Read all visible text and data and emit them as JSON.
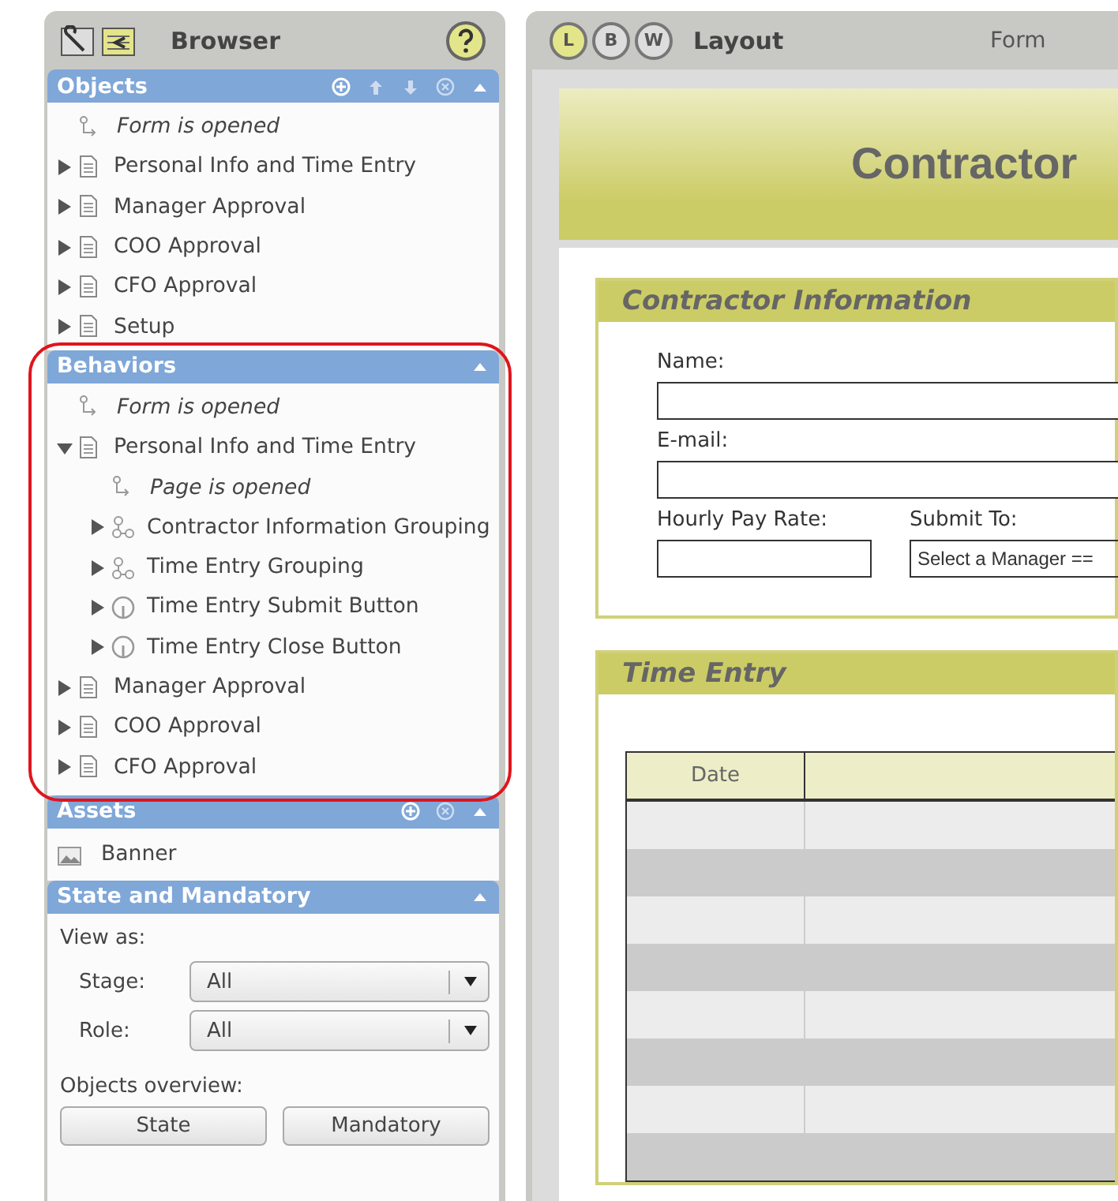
{
  "browser": {
    "title": "Browser",
    "objects": {
      "title": "Objects",
      "items": [
        {
          "kind": "event",
          "label": "Form is opened"
        },
        {
          "kind": "page",
          "label": "Personal Info and Time Entry",
          "expanded": false
        },
        {
          "kind": "page",
          "label": "Manager Approval",
          "expanded": false
        },
        {
          "kind": "page",
          "label": "COO Approval",
          "expanded": false
        },
        {
          "kind": "page",
          "label": "CFO Approval",
          "expanded": false
        },
        {
          "kind": "page",
          "label": "Setup",
          "expanded": false
        }
      ]
    },
    "behaviors": {
      "title": "Behaviors",
      "items": [
        {
          "kind": "event",
          "label": "Form is opened"
        },
        {
          "kind": "page",
          "label": "Personal Info and Time Entry",
          "expanded": true,
          "children": [
            {
              "kind": "event",
              "label": "Page is opened"
            },
            {
              "kind": "group",
              "label": "Contractor Information Grouping",
              "expanded": false
            },
            {
              "kind": "group",
              "label": "Time Entry Grouping",
              "expanded": false
            },
            {
              "kind": "button",
              "label": "Time Entry Submit Button",
              "expanded": false
            },
            {
              "kind": "button",
              "label": "Time Entry Close Button",
              "expanded": false
            }
          ]
        },
        {
          "kind": "page",
          "label": "Manager Approval",
          "expanded": false
        },
        {
          "kind": "page",
          "label": "COO Approval",
          "expanded": false
        },
        {
          "kind": "page",
          "label": "CFO Approval",
          "expanded": false
        }
      ]
    },
    "assets": {
      "title": "Assets",
      "items": [
        {
          "label": "Banner"
        }
      ]
    },
    "state_and_mandatory": {
      "title": "State and Mandatory",
      "view_as": "View as:",
      "selects": [
        {
          "label": "Stage:",
          "value": "All"
        },
        {
          "label": "Role:",
          "value": "All"
        }
      ],
      "overview": "Objects overview:",
      "buttons": [
        "State",
        "Mandatory"
      ]
    }
  },
  "layout": {
    "modes": [
      {
        "letter": "L",
        "selected": true
      },
      {
        "letter": "B",
        "selected": false
      },
      {
        "letter": "W",
        "selected": false
      }
    ],
    "title": "Layout",
    "tab": "Form",
    "banner_title": "Contractor",
    "sections": [
      {
        "title": "Contractor Information",
        "fields": [
          {
            "label": "Name:"
          },
          {
            "label": "E-mail:"
          }
        ],
        "rate_label": "Hourly Pay Rate:",
        "submit_label": "Submit To:",
        "submit_value": "Select a Manager =="
      },
      {
        "title": "Time Entry",
        "table": {
          "columns": [
            "Date"
          ]
        }
      }
    ]
  }
}
